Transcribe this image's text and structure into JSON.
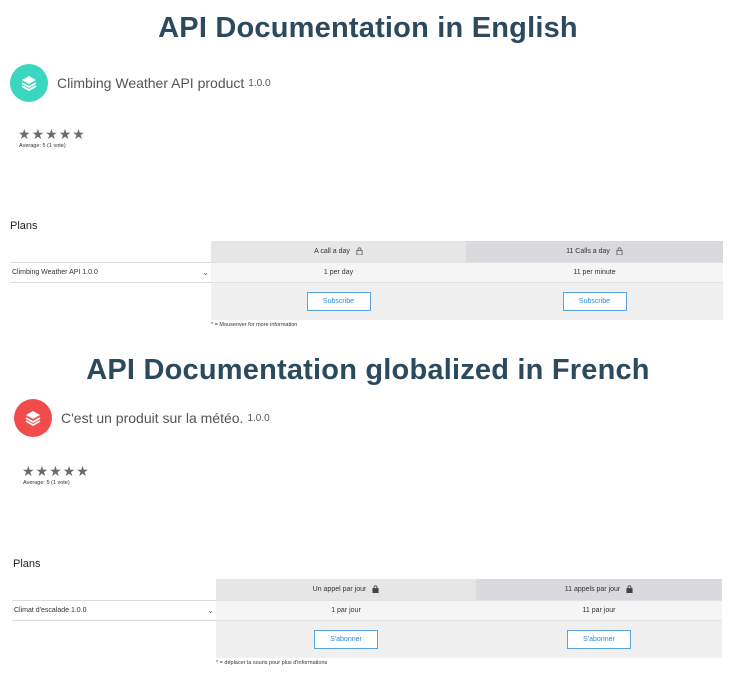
{
  "sections": [
    {
      "heading": "API Documentation in English",
      "logo_color": "#3ad6c0",
      "product_name": "Climbing Weather API product",
      "product_version": "1.0.0",
      "stars": 5,
      "average_text": "Average: 5 (1 vote)",
      "plans_title": "Plans",
      "plans": [
        {
          "name": "A call a day",
          "limit": "1 per day",
          "button": "Subscribe"
        },
        {
          "name": "11 Calls a day",
          "limit": "11 per minute",
          "button": "Subscribe"
        }
      ],
      "api_name": "Climbing Weather API 1.0.0",
      "note": "* = Mouseover for more information"
    },
    {
      "heading": "API Documentation globalized in French",
      "logo_color": "#f24b4b",
      "product_name": "C'est un produit sur la météo.",
      "product_version": "1.0.0",
      "stars": 5,
      "average_text": "Average: 5 (1 vote)",
      "plans_title": "Plans",
      "plans": [
        {
          "name": "Un appel par jour",
          "limit": "1 par jour",
          "button": "S'abonner"
        },
        {
          "name": "11 appels par jour",
          "limit": "11 par jour",
          "button": "S'abonner"
        }
      ],
      "api_name": "Climat d'escalade 1.0.0",
      "note": "* = déplacer la souris pour plus d'informations"
    }
  ]
}
